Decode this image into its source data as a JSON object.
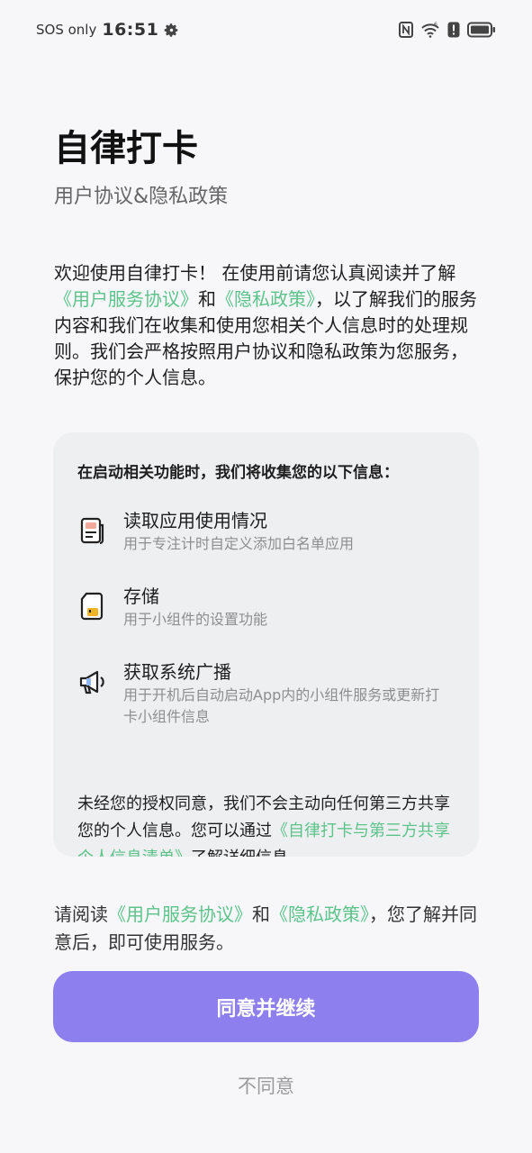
{
  "status_bar": {
    "carrier": "SOS only",
    "time": "16:51"
  },
  "header": {
    "title": "自律打卡",
    "subtitle": "用户协议&隐私政策"
  },
  "intro": {
    "part1": "欢迎使用自律打卡！ 在使用前请您认真阅读并了解",
    "link1": "《用户服务协议》",
    "part2": "和",
    "link2": "《隐私政策》",
    "part3": "，以了解我们的服务内容和我们在收集和使用您相关个人信息时的处理规则。我们会严格按照用户协议和隐私政策为您服务，保护您的个人信息。"
  },
  "panel": {
    "heading": "在启动相关功能时，我们将收集您的以下信息：",
    "permissions": [
      {
        "title": "读取应用使用情况",
        "desc": "用于专注计时自定义添加白名单应用",
        "icon": "app-usage-icon"
      },
      {
        "title": "存储",
        "desc": "用于小组件的设置功能",
        "icon": "storage-icon"
      },
      {
        "title": "获取系统广播",
        "desc": "用于开机后自动启动App内的小组件服务或更新打卡小组件信息",
        "icon": "broadcast-icon"
      }
    ],
    "footer_part1": "未经您的授权同意，我们不会主动向任何第三方共享您的个人信息。您可以通过",
    "footer_link": "《自律打卡与第三方共享个人信息清单》",
    "footer_part2": "了解详细信息"
  },
  "agree_note": {
    "part1": "请阅读",
    "link1": "《用户服务协议》",
    "part2": "和",
    "link2": "《隐私政策》",
    "part3": "，您了解并同意后，即可使用服务。"
  },
  "buttons": {
    "agree": "同意并继续",
    "disagree": "不同意"
  },
  "colors": {
    "accent": "#8d80ee",
    "link": "#5cc38a",
    "warning": "#e5a93a"
  }
}
